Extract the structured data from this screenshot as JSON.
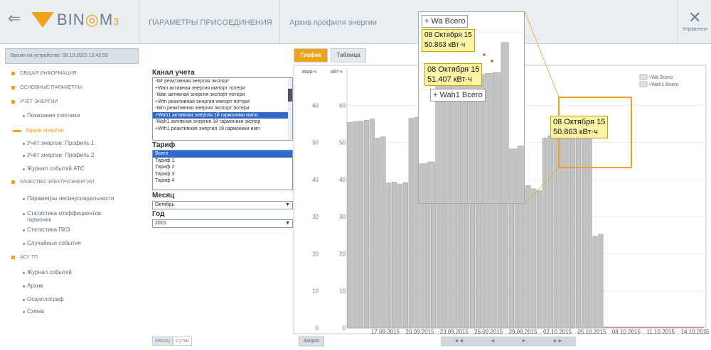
{
  "header": {
    "logo": {
      "v": "V",
      "bin": "BIN",
      "m": "M",
      "sub": "3"
    },
    "nav1": "ПАРАМЕТРЫ ПРИСОЕДИНЕНИЯ",
    "nav2": "Архив профиля энергии",
    "tools_label": "Управлени"
  },
  "device_time": "Время на устройстве: 08.10.2015 12:42:55",
  "sidebar": [
    {
      "label": "ОБЩАЯ ИНФОРМАЦИЯ",
      "kind": "section"
    },
    {
      "label": "ОСНОВНЫЕ ПАРАМЕТРЫ",
      "kind": "section"
    },
    {
      "label": "УЧЁТ ЭНЕРГИИ",
      "kind": "section"
    },
    {
      "label": "Показания счетчика",
      "kind": "item"
    },
    {
      "label": "Архив энергии",
      "kind": "active"
    },
    {
      "label": "Учёт энергии: Профиль 1",
      "kind": "item"
    },
    {
      "label": "Учёт энергии: Профиль 2",
      "kind": "item"
    },
    {
      "label": "Журнал событий АТС",
      "kind": "item"
    },
    {
      "label": "КАЧЕСТВО ЭЛЕКТРОЭНЕРГИИ",
      "kind": "section"
    },
    {
      "label": "Параметры несинусоидальности",
      "kind": "item"
    },
    {
      "label": "Статистика коэффициентов",
      "label2": "гармоник",
      "kind": "item"
    },
    {
      "label": "Статистика ПКЭ",
      "kind": "item"
    },
    {
      "label": "Случайные события",
      "kind": "item"
    },
    {
      "label": "АСУ ТП",
      "kind": "section"
    },
    {
      "label": "Журнал событий",
      "kind": "item"
    },
    {
      "label": "Архив",
      "kind": "item"
    },
    {
      "label": "Осциллограф",
      "kind": "item"
    },
    {
      "label": "Схема",
      "kind": "item"
    }
  ],
  "bottom_tabs": [
    "Месяц",
    "Сутки"
  ],
  "form": {
    "channel_label": "Канал учета",
    "channels": [
      "-Wr реактивная энергия экспорт",
      "+Wan активная энергия импорт потери",
      "-Wan активная энергия экспорт потери",
      "+Wrn реактивная энергия импорт потери",
      "-Wrn реактивная энергия экспорт потери",
      "+Wah1 активная энергия 1й гармоники импо",
      "-Wah1 активная энергия 1й гармоники экспор",
      "+Wrh1 реактивная энергия 1й гармоники имп"
    ],
    "channel_selected": 5,
    "tariff_label": "Тариф",
    "tariffs": [
      "Всего",
      "Тариф 1",
      "Тариф 2",
      "Тариф 3",
      "Тариф 4"
    ],
    "tariff_selected": 0,
    "month_label": "Месяц",
    "month_value": "Октябрь",
    "year_label": "Год",
    "year_value": "2015"
  },
  "tabs": [
    "График",
    "Таблица"
  ],
  "query_button": "Запрос",
  "nav_buttons": [
    "◄◄",
    "◄",
    "►",
    "►►"
  ],
  "chart_data": {
    "type": "bar",
    "y_units_left": "квар-ч",
    "y_units_right": "кВт-ч",
    "ylim": [
      0,
      70
    ],
    "yticks": [
      0,
      10,
      20,
      30,
      40,
      50,
      60
    ],
    "x_labels": [
      "17.09.2015",
      "20.09.2015",
      "23.09.2015",
      "26.09.2015",
      "29.09.2015",
      "02.10.2015",
      "05.10.2015",
      "08.10.2015",
      "11.10.2015",
      "14.10.2015"
    ],
    "legend": [
      "+Wa Всего",
      "+Wah1 Всего"
    ],
    "values": [
      55.4,
      55.6,
      55.7,
      56,
      56.3,
      51.2,
      51.5,
      39.1,
      39.3,
      38.8,
      39.2,
      56.5,
      56.8,
      57,
      57.5,
      58,
      58,
      58.3,
      58.5,
      65,
      42,
      42.6,
      57,
      57.1,
      58,
      58.5,
      53.9,
      53.7,
      50.4,
      51,
      52.5,
      38.1,
      38.4,
      37.5,
      37,
      51.2,
      51.8,
      51.9,
      51.6,
      51.5,
      51.4,
      52.2,
      52.4,
      52.7,
      24.7,
      25.3,
      0,
      0,
      0,
      0,
      0,
      0,
      0,
      0,
      0,
      0,
      0,
      0,
      0,
      0,
      0,
      0,
      0,
      0
    ],
    "grid": true,
    "legend_position": "top-right"
  },
  "tooltip_main": {
    "date": "08 Октября 15",
    "value": "50.863 кВт·ч"
  },
  "zoom_overlay": {
    "legend1": "+ Wa Всего",
    "legend2": "+ Wah1 Всего",
    "tip1": {
      "date": "08 Октября 15",
      "value": "50.863 кВт·ч"
    },
    "tip2": {
      "date": "08 Октября 15",
      "value": "51.407 кВт·ч"
    }
  }
}
